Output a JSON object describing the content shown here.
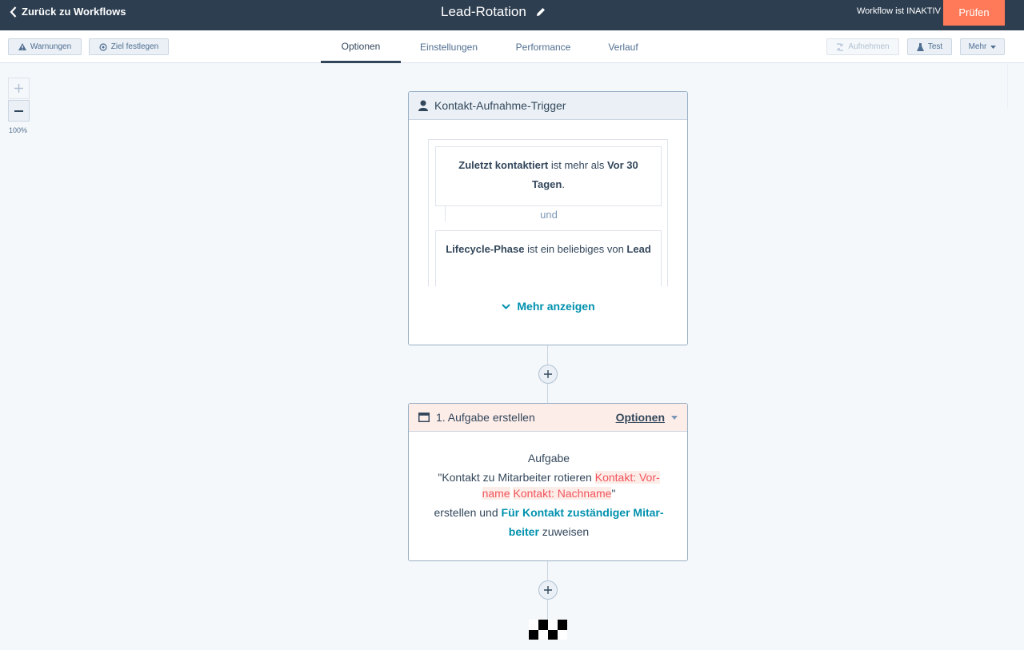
{
  "header": {
    "back_label": "Zurück zu Workflows",
    "workflow_title": "Lead-Rotation",
    "status_text": "Workflow ist INAKTIV",
    "review_button": "Prüfen"
  },
  "toolbar": {
    "warnings_label": "Warnungen",
    "goal_label": "Ziel festlegen",
    "tabs": [
      {
        "label": "Optionen",
        "active": true
      },
      {
        "label": "Einstellungen",
        "active": false
      },
      {
        "label": "Performance",
        "active": false
      },
      {
        "label": "Verlauf",
        "active": false
      }
    ],
    "enroll_label": "Aufnehmen",
    "test_label": "Test",
    "more_label": "Mehr"
  },
  "canvas": {
    "zoom_level": "100%"
  },
  "trigger": {
    "title": "Kontakt-Aufnahme-Trigger",
    "filter1": {
      "prop": "Zuletzt kontaktiert",
      "op": " ist mehr als ",
      "value": "Vor 30 Tagen",
      "end": "."
    },
    "joiner": "und",
    "filter2": {
      "prop": "Lifecycle-Phase",
      "op": " ist ein beliebiges von ",
      "value": "Lead"
    },
    "show_more": "Mehr anzeigen"
  },
  "action": {
    "title": "1. Aufgabe erstellen",
    "options_label": "Optionen",
    "line1": "Aufgabe",
    "quote_open": "\"",
    "task_text": "Kontakt zu Mitarbeiter rotieren ",
    "token_firstname_a": "Kontakt: Vor-",
    "token_firstname_b": "name",
    "token_lastname": "Kontakt: Nachname",
    "quote_close": "\"",
    "create_text": "erstellen und ",
    "owner_a": "Für Kontakt zuständiger Mitar-",
    "owner_b": "beiter",
    "assign_text": " zuweisen"
  },
  "colors": {
    "topbar": "#2d3e50",
    "accent_orange": "#ff7a59",
    "link_teal": "#0091ae",
    "token_red": "#f2545b"
  }
}
